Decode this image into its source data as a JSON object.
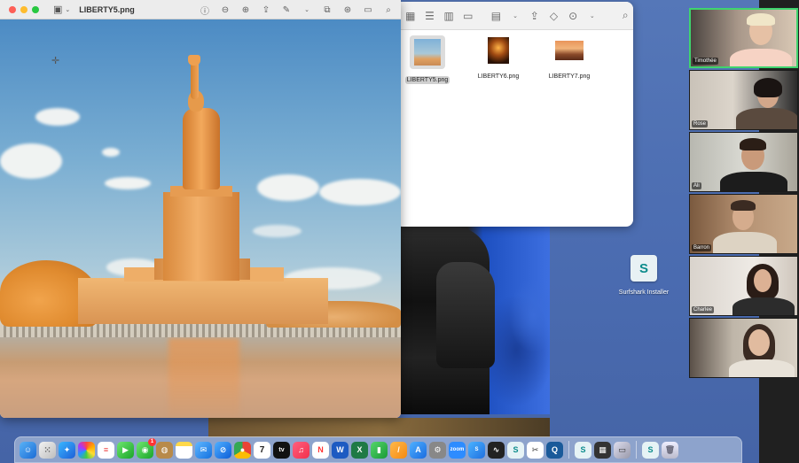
{
  "preview": {
    "title": "LIBERTY5.png"
  },
  "finder": {
    "files": [
      {
        "name": "LIBERTY5.png",
        "selected": true
      },
      {
        "name": "LIBERTY6.png",
        "selected": false
      },
      {
        "name": "LIBERTY7.png",
        "selected": false
      }
    ]
  },
  "desktop": {
    "icon_label": "Surfshark Installer"
  },
  "participants": [
    {
      "name": "Timothée",
      "active": true
    },
    {
      "name": "Rose",
      "active": false
    },
    {
      "name": "Ali",
      "active": false
    },
    {
      "name": "Barron",
      "active": false
    },
    {
      "name": "Charlee",
      "active": false
    },
    {
      "name": "",
      "active": false
    }
  ],
  "dock": {
    "calendar_day": "7",
    "facetime_badge": "1"
  },
  "colors": {
    "active_speaker": "#3fd46e",
    "desktop": "#4a6bb0",
    "close": "#fe5f57",
    "minimize": "#febc2e",
    "zoom": "#28c840"
  }
}
